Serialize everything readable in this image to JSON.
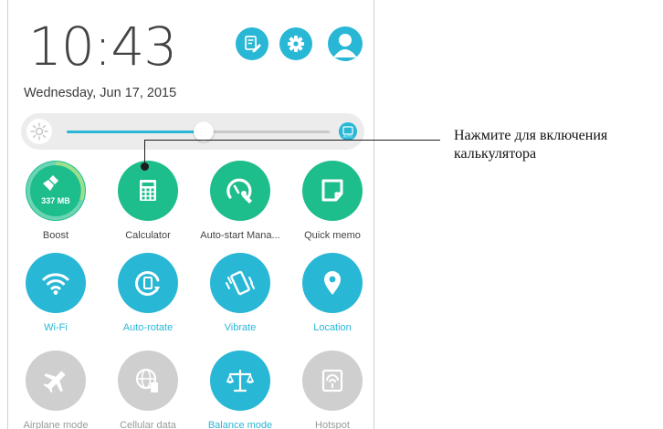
{
  "status": {
    "time": "10:43",
    "date": "Wednesday, Jun 17, 2015"
  },
  "top_icons": [
    "edit-notes-icon",
    "settings-gear-icon",
    "user-avatar-icon"
  ],
  "brightness": {
    "level": 0.52,
    "auto_label": "AUTO"
  },
  "tiles": [
    {
      "label": "Boost",
      "icon": "boost-broom-icon",
      "state": "on",
      "badge": "337 MB"
    },
    {
      "label": "Calculator",
      "icon": "calculator-icon",
      "state": "on"
    },
    {
      "label": "Auto-start Mana...",
      "icon": "auto-start-manager-icon",
      "state": "on"
    },
    {
      "label": "Quick memo",
      "icon": "quick-memo-icon",
      "state": "on"
    },
    {
      "label": "Wi-Fi",
      "icon": "wifi-icon",
      "state": "on"
    },
    {
      "label": "Auto-rotate",
      "icon": "auto-rotate-icon",
      "state": "on"
    },
    {
      "label": "Vibrate",
      "icon": "vibrate-icon",
      "state": "on"
    },
    {
      "label": "Location",
      "icon": "location-pin-icon",
      "state": "on"
    },
    {
      "label": "Airplane mode",
      "icon": "airplane-icon",
      "state": "off"
    },
    {
      "label": "Cellular data",
      "icon": "cellular-data-icon",
      "state": "off"
    },
    {
      "label": "Balance mode",
      "icon": "balance-scale-icon",
      "state": "on"
    },
    {
      "label": "Hotspot",
      "icon": "hotspot-icon",
      "state": "off"
    }
  ],
  "annotation": {
    "text": "Нажмите для включения калькулятора"
  },
  "colors": {
    "green": "#1ebd8c",
    "blue": "#29b7d6",
    "disabled": "#cfcfcf"
  }
}
